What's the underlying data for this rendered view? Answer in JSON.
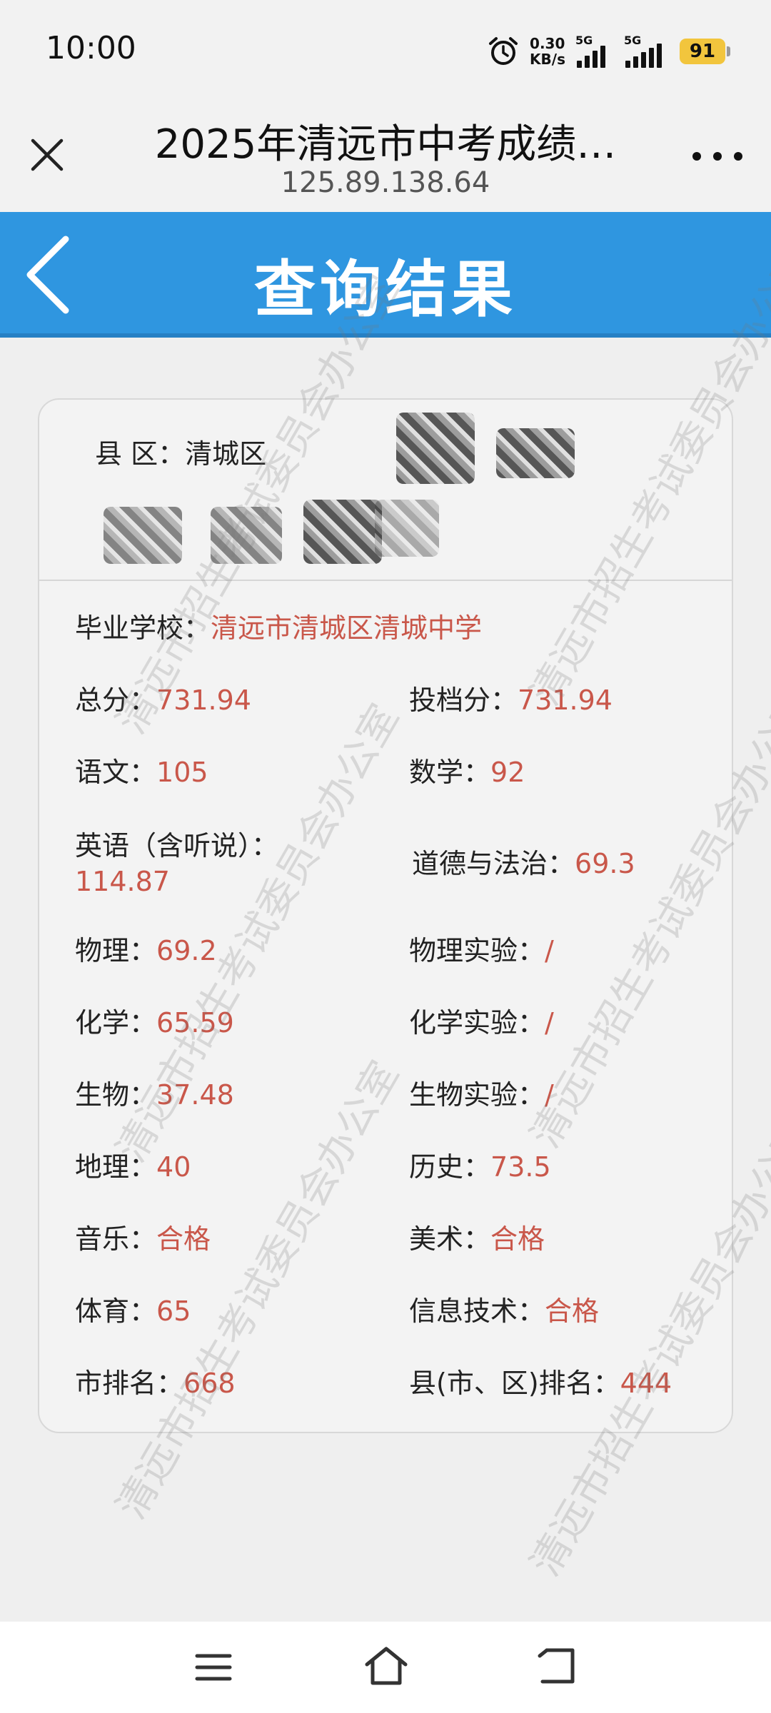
{
  "status_bar": {
    "time": "10:00",
    "net_speed_value": "0.30",
    "net_speed_unit": "KB/s",
    "sim1": "5G",
    "sim2": "5G",
    "battery": "91",
    "battery_color": "#f2c53d"
  },
  "browser": {
    "title": "2025年清远市中考成绩…",
    "url": "125.89.138.64"
  },
  "header": {
    "title": "查询结果",
    "color": "#2f96e0"
  },
  "card": {
    "county_label": "县 区：",
    "county_value": "清城区",
    "fields": {
      "school_label": "毕业学校：",
      "school_value": "清远市清城区清城中学",
      "total_label": "总分：",
      "total_value": "731.94",
      "admission_label": "投档分：",
      "admission_value": "731.94",
      "chinese_label": "语文：",
      "chinese_value": "105",
      "math_label": "数学：",
      "math_value": "92",
      "english_label": "英语（含听说）：",
      "english_value": "114.87",
      "morality_label": "道德与法治：",
      "morality_value": "69.3",
      "physics_label": "物理：",
      "physics_value": "69.2",
      "physics_lab_label": "物理实验：",
      "physics_lab_value": "/",
      "chemistry_label": "化学：",
      "chemistry_value": "65.59",
      "chemistry_lab_label": "化学实验：",
      "chemistry_lab_value": "/",
      "biology_label": "生物：",
      "biology_value": "37.48",
      "biology_lab_label": "生物实验：",
      "biology_lab_value": "/",
      "geography_label": "地理：",
      "geography_value": "40",
      "history_label": "历史：",
      "history_value": "73.5",
      "music_label": "音乐：",
      "music_value": "合格",
      "art_label": "美术：",
      "art_value": "合格",
      "pe_label": "体育：",
      "pe_value": "65",
      "it_label": "信息技术：",
      "it_value": "合格",
      "city_rank_label": "市排名：",
      "city_rank_value": "668",
      "county_rank_label": "县(市、区)排名：",
      "county_rank_value": "444"
    },
    "value_color": "#c9574a"
  },
  "watermark": {
    "text": "清远市招生考试委员会办公室"
  }
}
